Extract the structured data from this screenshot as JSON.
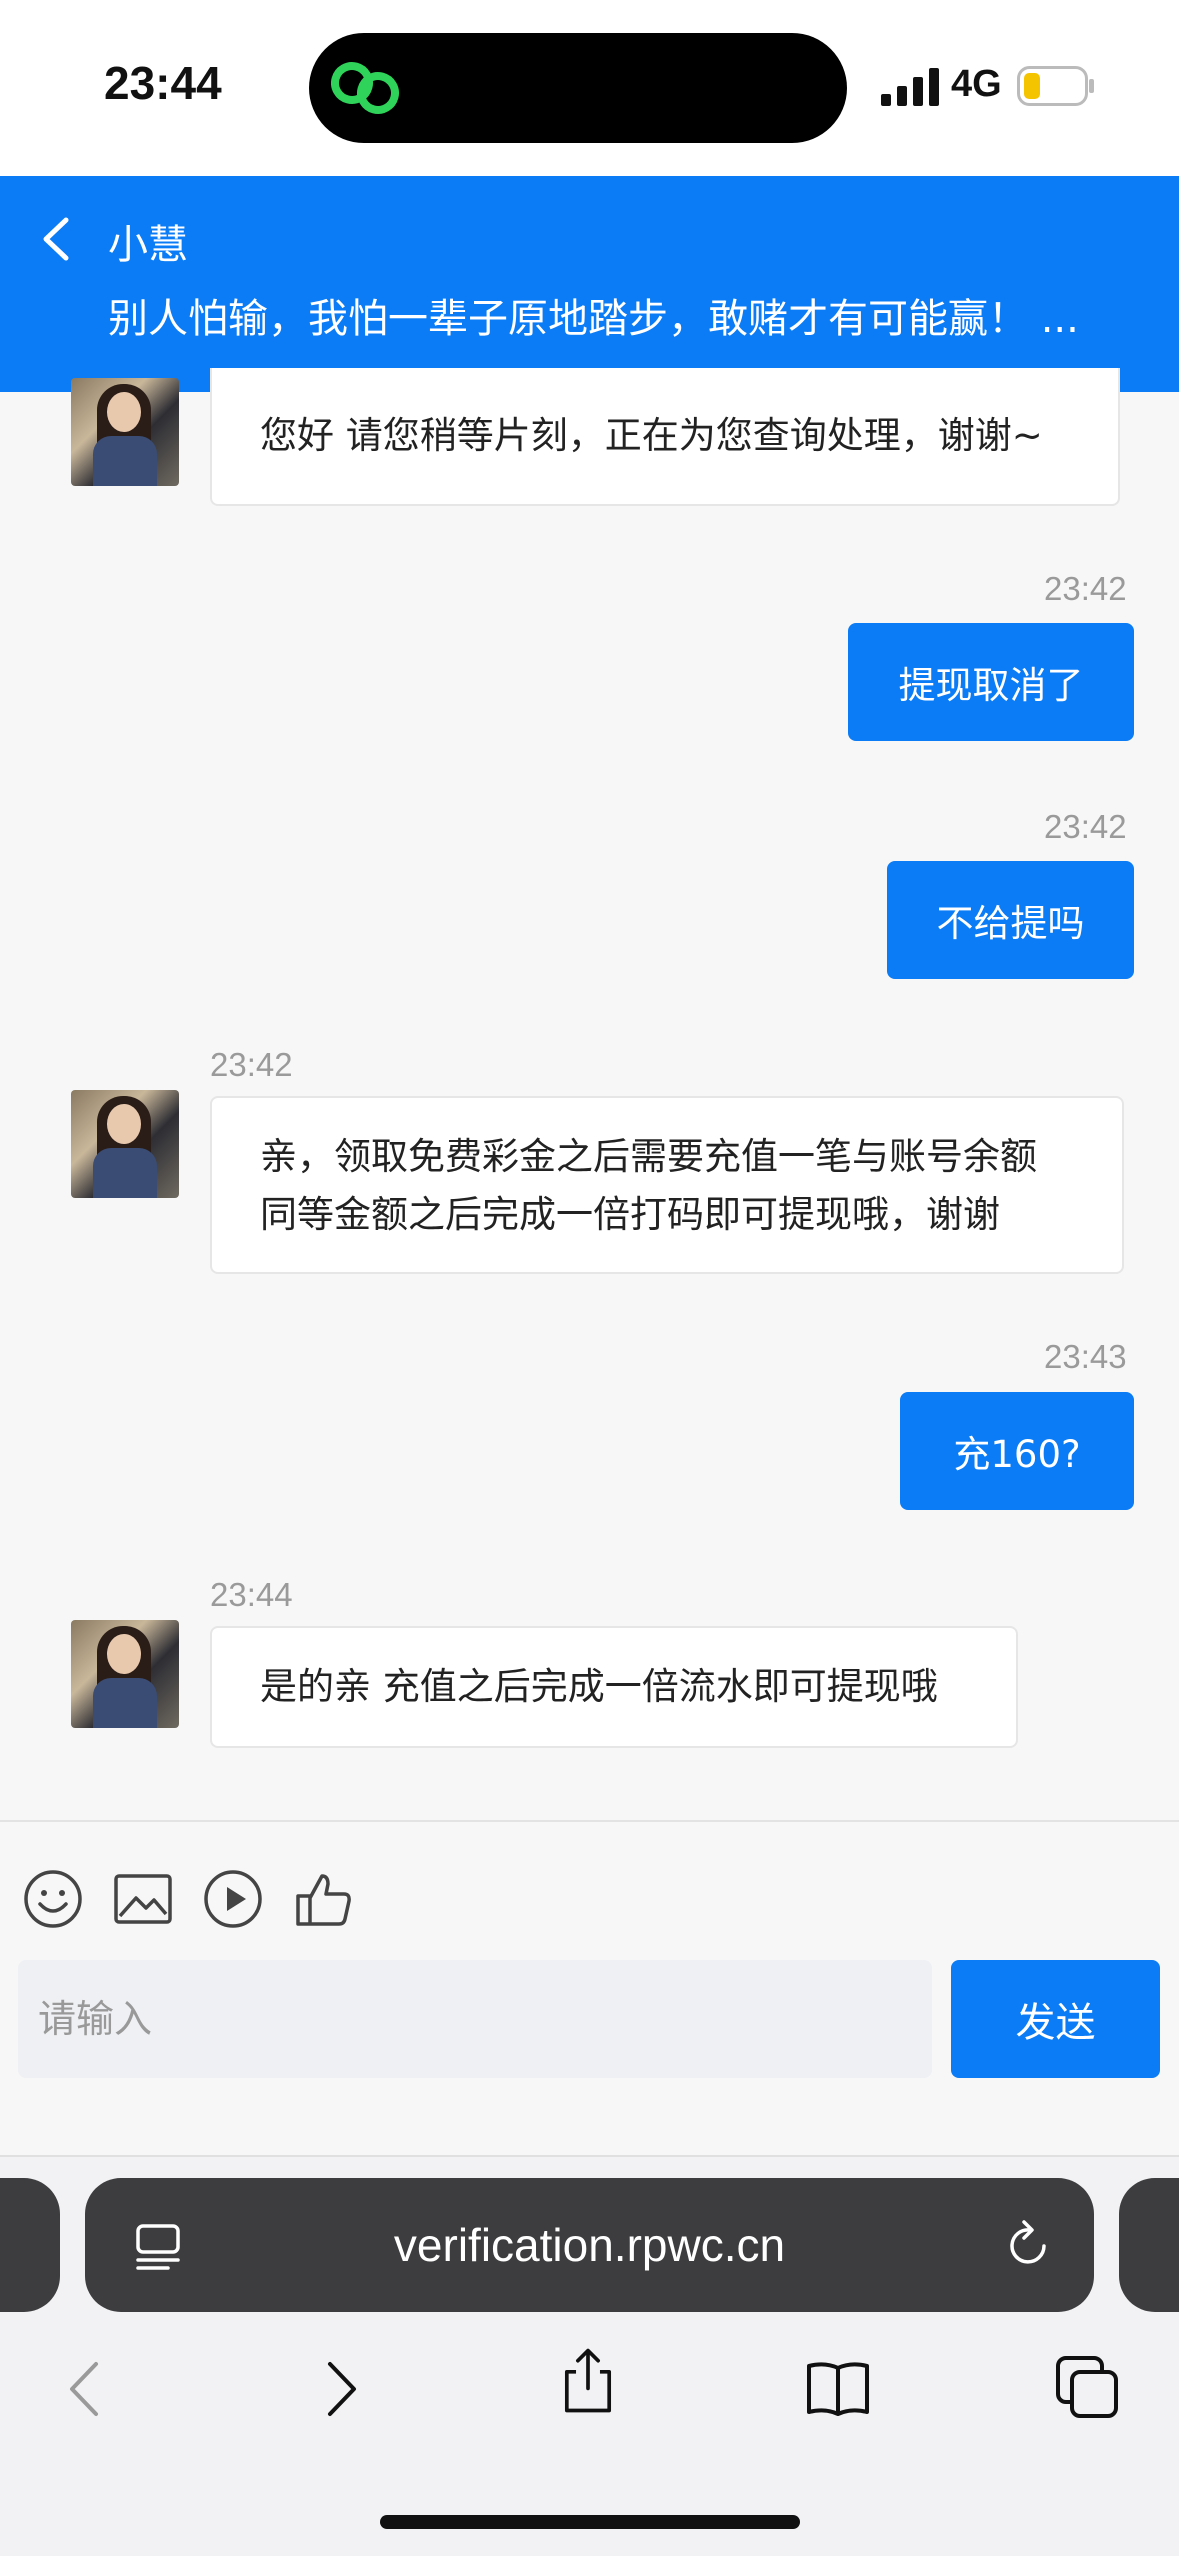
{
  "status_bar": {
    "time": "23:44",
    "network": "4G"
  },
  "header": {
    "title": "小慧",
    "subtitle": "别人怕输，我怕一辈子原地踏步，敢赌才有可能赢！ ..."
  },
  "messages": [
    {
      "text": "您好 请您稍等片刻，正在为您查询处理，谢谢~"
    },
    {
      "time": "23:42",
      "text": "提现取消了"
    },
    {
      "time": "23:42",
      "text": "不给提吗"
    },
    {
      "time": "23:42",
      "line1": "亲，领取免费彩金之后需要充值一笔与账号余额",
      "line2": "同等金额之后完成一倍打码即可提现哦，谢谢"
    },
    {
      "time": "23:43",
      "text": "充160?"
    },
    {
      "time": "23:44",
      "text": "是的亲 充值之后完成一倍流水即可提现哦"
    }
  ],
  "input": {
    "placeholder": "请输入",
    "send_label": "发送"
  },
  "browser": {
    "url": "verification.rpwc.cn"
  },
  "colors": {
    "accent": "#0b7cf5"
  }
}
